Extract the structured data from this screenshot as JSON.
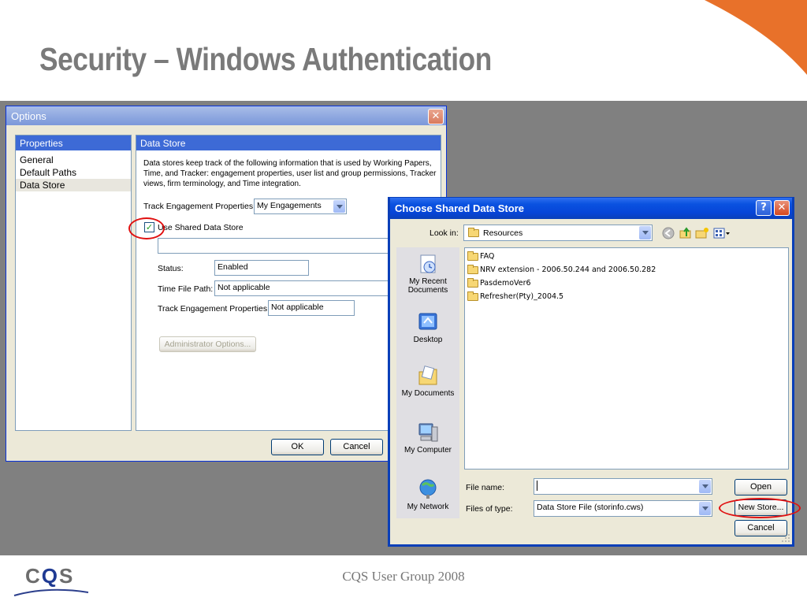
{
  "slide": {
    "title": "Security – Windows Authentication",
    "footer": "CQS User Group 2008",
    "logo": {
      "c": "C",
      "q": "Q",
      "s": "S"
    }
  },
  "colors": {
    "accent_orange": "#e8712a",
    "title_gray": "#7a7a7a",
    "xp_blue": "#0a52e0",
    "ring_red": "#e01010"
  },
  "options": {
    "title": "Options",
    "close_label": "✕",
    "properties": {
      "header": "Properties",
      "items": [
        "General",
        "Default Paths",
        "Data Store"
      ]
    },
    "datastore": {
      "header": "Data Store",
      "description": [
        "Data stores keep track of the following information that is used by Working Papers,",
        "Time, and Tracker: engagement properties, user list and group permissions, Tracker",
        "views, firm terminology, and Time integration."
      ],
      "track_label": "Track Engagement Properties:",
      "track_value": "My Engagements",
      "use_shared_label": "Use Shared Data Store",
      "use_shared_checked": "✓",
      "path_value": "",
      "status_label": "Status:",
      "status_value": "Enabled",
      "time_file_label": "Time File Path:",
      "time_file_value": "Not applicable",
      "track_props_label": "Track Engagement Properties:",
      "track_props_value": "Not applicable",
      "admin_button": "Administrator Options..."
    },
    "ok_button": "OK",
    "cancel_button": "Cancel"
  },
  "chooser": {
    "title": "Choose Shared Data Store",
    "help_label": "?",
    "close_label": "✕",
    "look_in_label": "Look in:",
    "look_in_value": "Resources",
    "places": [
      "My Recent Documents",
      "Desktop",
      "My Documents",
      "My Computer",
      "My Network"
    ],
    "files": [
      "FAQ",
      "NRV extension - 2006.50.244 and 2006.50.282",
      "PasdemoVer6",
      "Refresher(Pty)_2004.5"
    ],
    "file_name_label": "File name:",
    "file_name_value": "",
    "file_type_label": "Files of type:",
    "file_type_value": "Data Store File (storinfo.cws)",
    "open_button": "Open",
    "new_store_button": "New Store...",
    "cancel_button": "Cancel"
  }
}
